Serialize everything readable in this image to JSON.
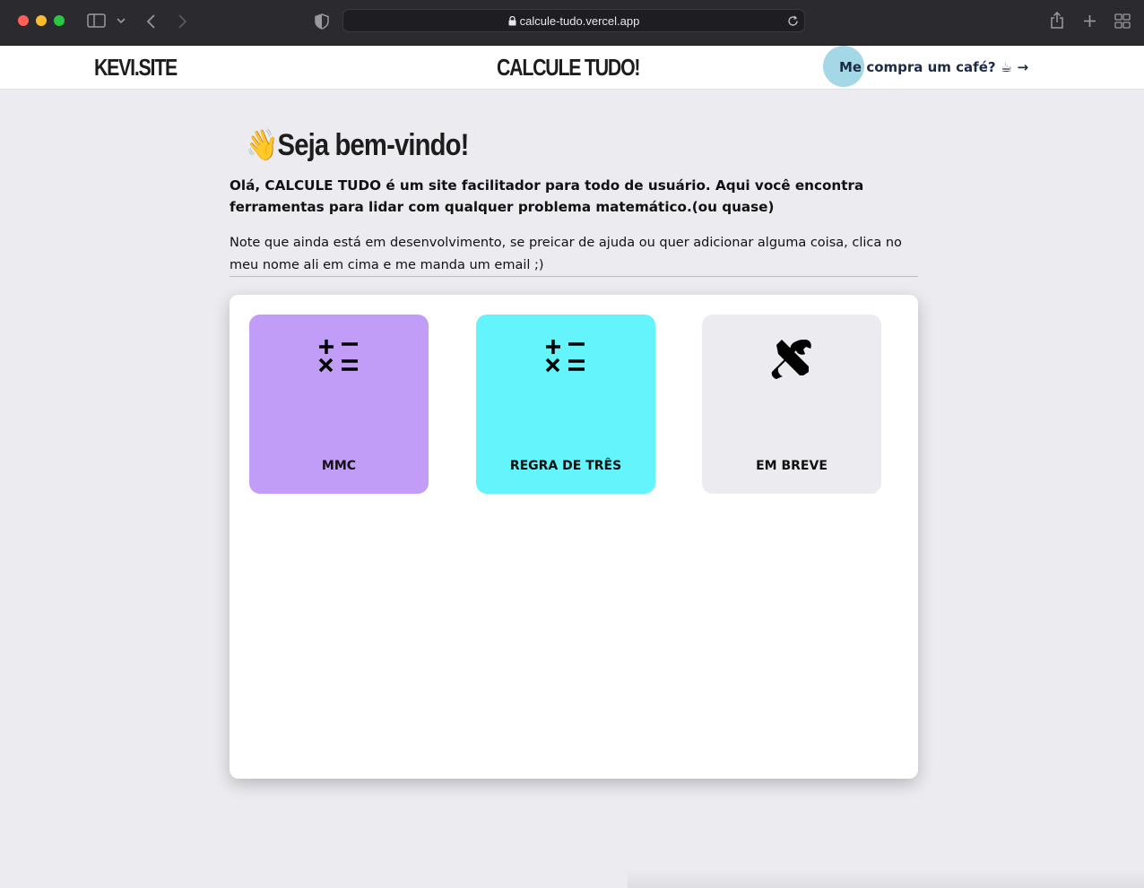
{
  "browser": {
    "url": "calcule-tudo.vercel.app",
    "icons": [
      "sidebar-icon",
      "chevron-down-icon",
      "back-icon",
      "forward-icon",
      "shield-icon",
      "lock-icon",
      "reload-icon",
      "share-icon",
      "new-tab-icon",
      "tab-overview-icon"
    ]
  },
  "header": {
    "brand": "KEVI.SITE",
    "title": "CALCULE TUDO!",
    "coffee_link": "Me compra um café? ☕ →"
  },
  "main": {
    "welcome_emoji": "👋",
    "welcome_title": "Seja bem-vindo!",
    "intro": "Olá, CALCULE TUDO é um site facilitador para todo de usuário. Aqui você encontra ferramentas para lidar com qualquer problema matemático.(ou quase)",
    "note": "Note que ainda está em desenvolvimento, se preicar de ajuda ou quer adicionar alguma coisa, clica no meu nome ali em cima e me manda um email ;)"
  },
  "cards": [
    {
      "label": "MMC",
      "icon": "calculator-ops-icon",
      "color": "#c19df8"
    },
    {
      "label": "REGRA DE TRÊS",
      "icon": "calculator-ops-icon",
      "color": "#64f4fb"
    },
    {
      "label": "EM BREVE",
      "icon": "tools-icon",
      "color": "#ececf0"
    }
  ]
}
